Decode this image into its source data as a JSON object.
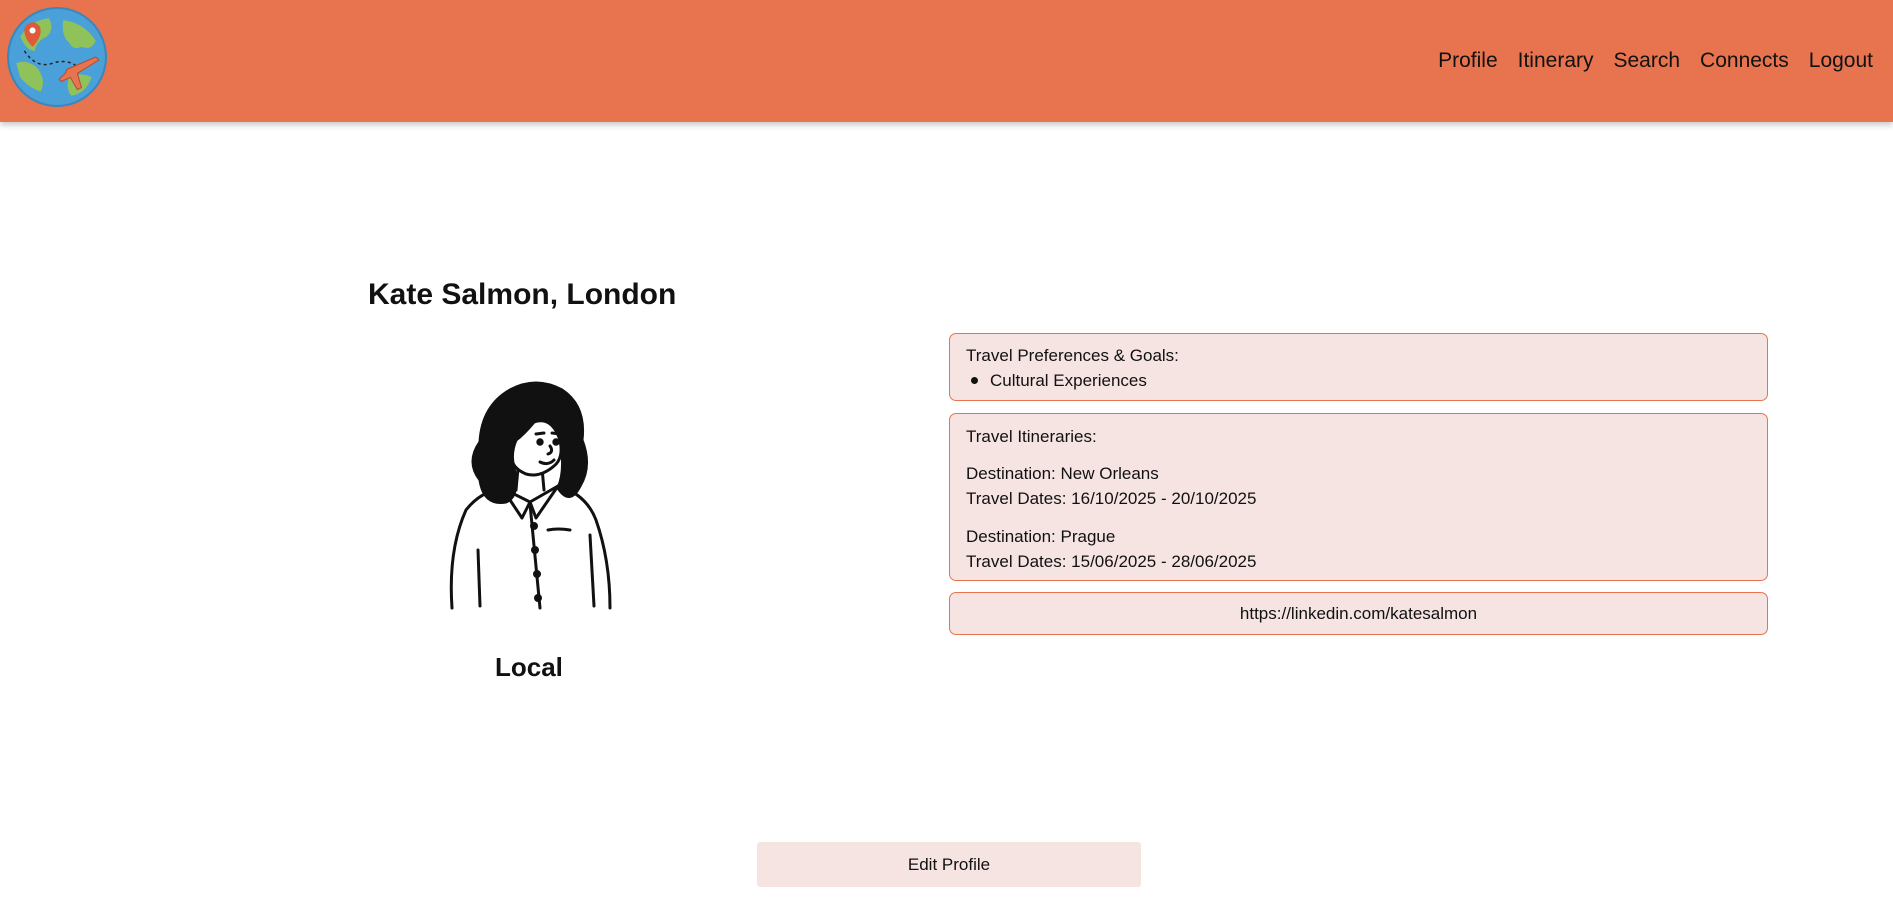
{
  "nav": {
    "logo_icon": "globe-travel-logo",
    "links": [
      "Profile",
      "Itinerary",
      "Search",
      "Connects",
      "Logout"
    ]
  },
  "profile": {
    "name_location": "Kate Salmon, London",
    "avatar_icon": "woman-avatar-illustration",
    "role": "Local"
  },
  "preferences": {
    "heading": "Travel Preferences & Goals:",
    "items": [
      "Cultural Experiences"
    ]
  },
  "itineraries": {
    "heading": "Travel Itineraries:",
    "trips": [
      {
        "destination": "Destination: New Orleans",
        "dates": "Travel Dates: 16/10/2025 - 20/10/2025"
      },
      {
        "destination": "Destination: Prague",
        "dates": "Travel Dates: 15/06/2025 - 28/06/2025"
      }
    ]
  },
  "social_link": "https://linkedin.com/katesalmon",
  "edit_button_label": "Edit Profile",
  "colors": {
    "navbar": "#e7744f",
    "card_bg": "#f6e4e3",
    "card_border": "#e7744f"
  }
}
